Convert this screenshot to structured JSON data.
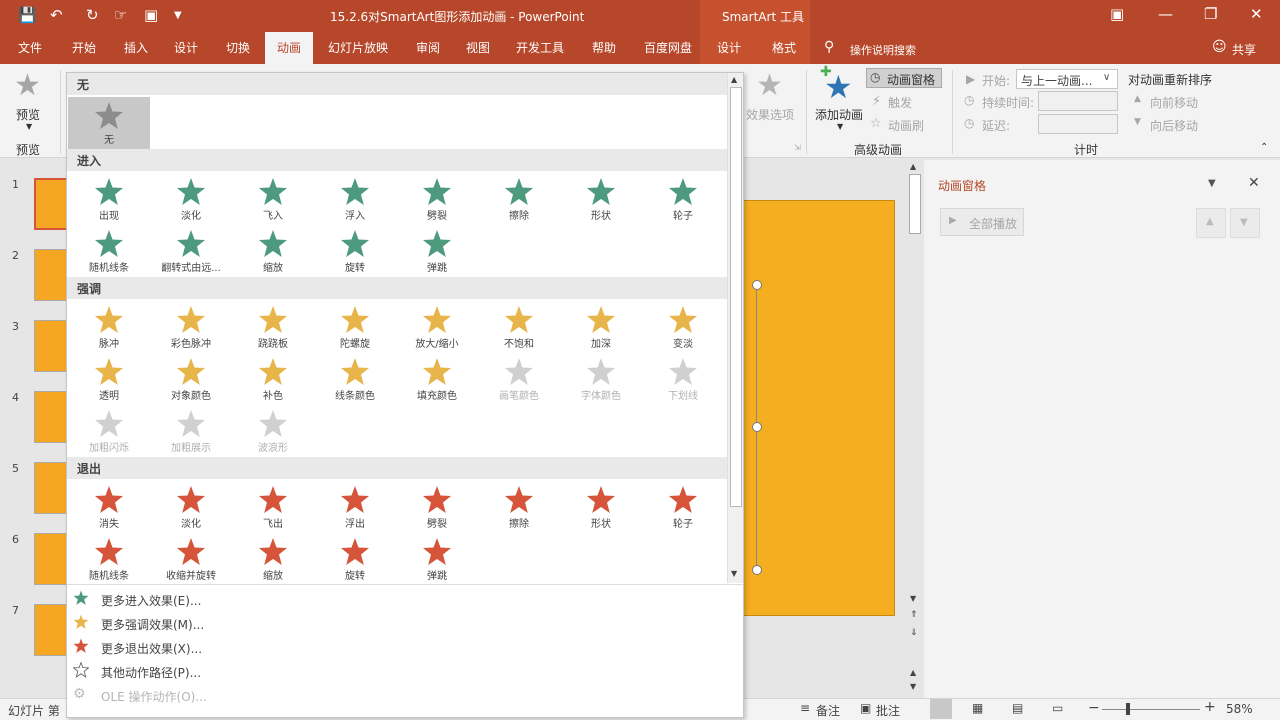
{
  "titlebar": {
    "doc_title": "15.2.6对SmartArt图形添加动画 - PowerPoint",
    "tools_label": "SmartArt 工具"
  },
  "tabs": [
    {
      "label": "文件"
    },
    {
      "label": "开始"
    },
    {
      "label": "插入"
    },
    {
      "label": "设计"
    },
    {
      "label": "切换"
    },
    {
      "label": "动画"
    },
    {
      "label": "幻灯片放映"
    },
    {
      "label": "审阅"
    },
    {
      "label": "视图"
    },
    {
      "label": "开发工具"
    },
    {
      "label": "帮助"
    },
    {
      "label": "百度网盘"
    },
    {
      "label": "设计"
    },
    {
      "label": "格式"
    }
  ],
  "tell_me": "操作说明搜索",
  "share": "共享",
  "ribbon": {
    "preview": "预览",
    "preview_group": "预览",
    "effect_options": "效果选项",
    "add_animation": "添加动画",
    "animation_pane": "动画窗格",
    "trigger": "触发",
    "animation_painter": "动画刷",
    "advanced_group": "高级动画",
    "start_label": "开始:",
    "start_value": "与上一动画...",
    "duration_label": "持续时间:",
    "delay_label": "延迟:",
    "timing_group": "计时",
    "reorder_title": "对动画重新排序",
    "move_earlier": "向前移动",
    "move_later": "向后移动"
  },
  "gallery": {
    "none_header": "无",
    "none_item": "无",
    "enter_header": "进入",
    "emphasis_header": "强调",
    "exit_header": "退出",
    "enter": [
      "出现",
      "淡化",
      "飞入",
      "浮入",
      "劈裂",
      "擦除",
      "形状",
      "轮子",
      "随机线条",
      "翻转式由远...",
      "缩放",
      "旋转",
      "弹跳"
    ],
    "emphasis": [
      "脉冲",
      "彩色脉冲",
      "跷跷板",
      "陀螺旋",
      "放大/缩小",
      "不饱和",
      "加深",
      "变淡",
      "透明",
      "对象颜色",
      "补色",
      "线条颜色",
      "填充颜色",
      "画笔颜色",
      "字体颜色",
      "下划线",
      "加粗闪烁",
      "加粗展示",
      "波浪形"
    ],
    "exit": [
      "消失",
      "淡化",
      "飞出",
      "浮出",
      "劈裂",
      "擦除",
      "形状",
      "轮子",
      "随机线条",
      "收缩并旋转",
      "缩放",
      "旋转",
      "弹跳"
    ],
    "more": [
      {
        "label": "更多进入效果(E)..."
      },
      {
        "label": "更多强调效果(M)..."
      },
      {
        "label": "更多退出效果(X)..."
      },
      {
        "label": "其他动作路径(P)..."
      },
      {
        "label": "OLE 操作动作(O)..."
      }
    ]
  },
  "thumbs": [
    "1",
    "2",
    "3",
    "4",
    "5",
    "6",
    "7"
  ],
  "pane": {
    "title": "动画窗格",
    "play_all": "全部播放"
  },
  "status": {
    "slide_info": "幻灯片 第",
    "notes": "备注",
    "comments": "批注",
    "zoom": "58%"
  },
  "colors": {
    "accent": "#b7472a",
    "enter": "#4e9a7f",
    "emphasis": "#e8b54a",
    "exit": "#d5543a",
    "slide": "#f5ae20"
  }
}
